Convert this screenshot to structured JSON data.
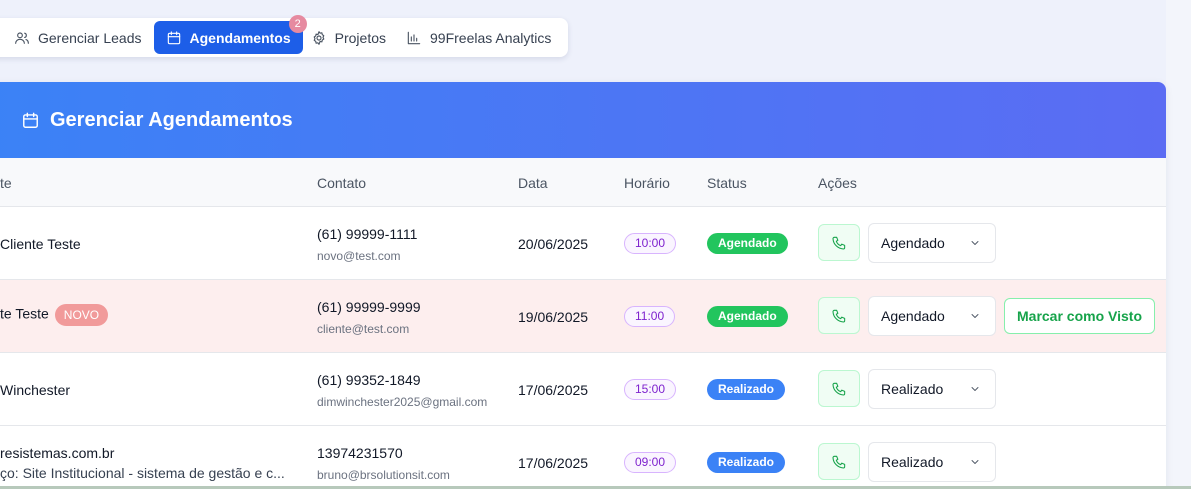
{
  "tabs": [
    {
      "label": "Gerenciar Leads",
      "icon": "users-icon",
      "active": false
    },
    {
      "label": "Agendamentos",
      "icon": "calendar-icon",
      "active": true,
      "badge": "2"
    },
    {
      "label": "Projetos",
      "icon": "gear-icon",
      "active": false
    },
    {
      "label": "99Freelas Analytics",
      "icon": "bar-chart-icon",
      "active": false
    }
  ],
  "card": {
    "title": "Gerenciar Agendamentos"
  },
  "table": {
    "headers": {
      "cliente": "te",
      "contato": "Contato",
      "data": "Data",
      "horario": "Horário",
      "status": "Status",
      "acoes": "Ações"
    },
    "rows": [
      {
        "name": "Cliente Teste",
        "phone": "(61) 99999-1111",
        "email": "novo@test.com",
        "date": "20/06/2025",
        "time": "10:00",
        "status": "Agendado",
        "select_value": "Agendado"
      },
      {
        "name": "te Teste",
        "badge": "NOVO",
        "phone": "(61) 99999-9999",
        "email": "cliente@test.com",
        "date": "19/06/2025",
        "time": "11:00",
        "status": "Agendado",
        "select_value": "Agendado",
        "action_label": "Marcar como Visto"
      },
      {
        "name": "Winchester",
        "phone": "(61) 99352-1849",
        "email": "dimwinchester2025@gmail.com",
        "date": "17/06/2025",
        "time": "15:00",
        "status": "Realizado",
        "select_value": "Realizado"
      },
      {
        "name": "resistemas.com.br",
        "sub": "ço: Site Institucional - sistema de gestão e c...",
        "phone": "13974231570",
        "email": "bruno@brsolutionsit.com",
        "date": "17/06/2025",
        "time": "09:00",
        "status": "Realizado",
        "select_value": "Realizado"
      }
    ]
  },
  "colors": {
    "accent": "#1d5ee8",
    "header_gradient_start": "#3b82f6",
    "header_gradient_end": "#5b6cf3",
    "status_agendado": "#22c55e",
    "status_realizado": "#3b82f6",
    "highlight_row": "#fdeeee"
  }
}
